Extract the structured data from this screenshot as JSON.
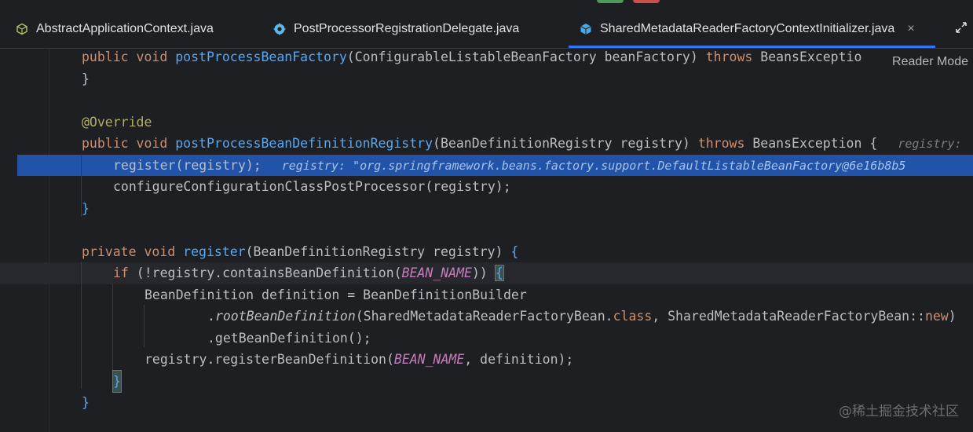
{
  "tabs": [
    {
      "label": "AbstractApplicationContext.java",
      "icon": "class-outline-icon",
      "active": false
    },
    {
      "label": "PostProcessorRegistrationDelegate.java",
      "icon": "class-gear-icon",
      "active": false
    },
    {
      "label": "SharedMetadataReaderFactoryContextInitializer.java",
      "icon": "class-cube-icon",
      "active": true
    }
  ],
  "toolbar": {
    "reader_mode": "Reader Mode",
    "close_glyph": "×"
  },
  "code": {
    "l1_kw": "public void ",
    "l1_fn": "postProcessBeanFactory",
    "l1_rest": "(ConfigurableListableBeanFactory beanFactory) ",
    "l1_throws": "throws",
    "l1_exc": " BeansExceptio",
    "l2": "}",
    "l4": "@Override",
    "l5_kw": "public void ",
    "l5_fn": "postProcessBeanDefinitionRegistry",
    "l5_rest": "(BeanDefinitionRegistry registry) ",
    "l5_throws": "throws",
    "l5_exc": " BeansException {",
    "l5_hint": "registry:",
    "l6_call": "register(registry);",
    "l6_hint": "registry: \"org.springframework.beans.factory.support.DefaultListableBeanFactory@6e16b8b5",
    "l7": "configureConfigurationClassPostProcessor(registry);",
    "l8": "}",
    "l10_kw": "private void ",
    "l10_fn": "register",
    "l10_rest": "(BeanDefinitionRegistry registry) ",
    "l10_brace": "{",
    "l11_kw": "if",
    "l11_a": " (!registry.containsBeanDefinition(",
    "l11_const": "BEAN_NAME",
    "l11_b": ")) ",
    "l11_brace": "{",
    "l12": "BeanDefinition definition = BeanDefinitionBuilder",
    "l13_dot": ".",
    "l13_it": "rootBeanDefinition",
    "l13_a": "(SharedMetadataReaderFactoryBean.",
    "l13_class": "class",
    "l13_b": ", SharedMetadataReaderFactoryBean::",
    "l13_new": "new",
    "l13_c": ")",
    "l14": ".getBeanDefinition();",
    "l15_a": "registry.registerBeanDefinition(",
    "l15_const": "BEAN_NAME",
    "l15_b": ", definition);",
    "l16": "}",
    "l17": "}"
  },
  "watermark": "@稀土掘金技术社区",
  "colors": {
    "accent": "#3574f0",
    "selection": "#2154a8",
    "keyword": "#cf8e6d",
    "function": "#56a8f5",
    "annotation": "#b3ae60",
    "constant": "#c77dbb"
  }
}
